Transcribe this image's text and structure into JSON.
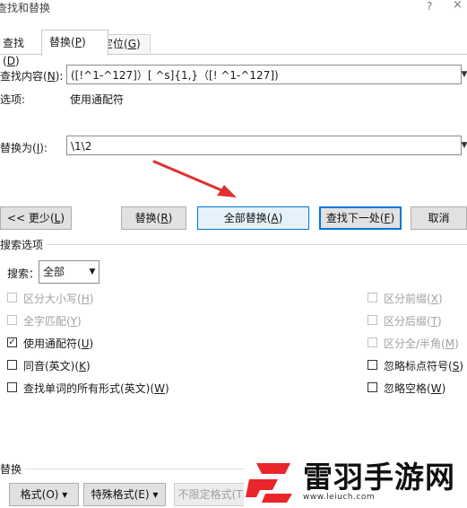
{
  "window": {
    "title": "查找和替换",
    "help": "?",
    "close": "×"
  },
  "tabs": {
    "find_label": "查找",
    "find_key": "D",
    "replace_label": "替换",
    "replace_key": "P",
    "goto_label": "定位",
    "goto_key": "G"
  },
  "find": {
    "label": "查找内容",
    "key": "N",
    "value": "([!^1-^127]）[ ^s]{1,}（[! ^1-^127])"
  },
  "options": {
    "label": "选项:",
    "value": "使用通配符"
  },
  "replace": {
    "label": "替换为",
    "key": "I",
    "value": "\\1\\2"
  },
  "buttons": {
    "less": "<< 更少",
    "less_key": "L",
    "replace": "替换",
    "replace_key": "R",
    "replace_all": "全部替换",
    "replace_all_key": "A",
    "find_next": "查找下一处",
    "find_next_key": "F",
    "cancel": "取消"
  },
  "search_options": {
    "title": "搜索选项",
    "search_label": "搜索",
    "search_key": "：",
    "search_value": "全部",
    "checkboxes_left": [
      {
        "label": "区分大小写",
        "key": "H",
        "checked": false,
        "disabled": true
      },
      {
        "label": "全字匹配",
        "key": "Y",
        "checked": false,
        "disabled": true
      },
      {
        "label": "使用通配符",
        "key": "U",
        "checked": true,
        "disabled": false
      },
      {
        "label": "同音(英文)",
        "key": "K",
        "checked": false,
        "disabled": false
      },
      {
        "label": "查找单词的所有形式(英文)",
        "key": "W",
        "checked": false,
        "disabled": false
      }
    ],
    "checkboxes_right": [
      {
        "label": "区分前缀",
        "key": "X",
        "checked": false,
        "disabled": true
      },
      {
        "label": "区分后缀",
        "key": "T",
        "checked": false,
        "disabled": true
      },
      {
        "label": "区分全/半角",
        "key": "M",
        "checked": false,
        "disabled": true
      },
      {
        "label": "忽略标点符号",
        "key": "S",
        "checked": false,
        "disabled": false
      },
      {
        "label": "忽略空格",
        "key": "W",
        "checked": false,
        "disabled": false
      }
    ]
  },
  "replace_group": {
    "title": "替换",
    "format_btn": "格式(O)",
    "special_btn": "特殊格式(E)",
    "no_format_btn": "不限定格式(T)"
  },
  "watermark": {
    "name": "雷羽手游网",
    "url": "www.leiuch.com",
    "accent": "#e8262b"
  },
  "colors": {
    "accent": "#0078d7",
    "arrow": "#e03030"
  }
}
